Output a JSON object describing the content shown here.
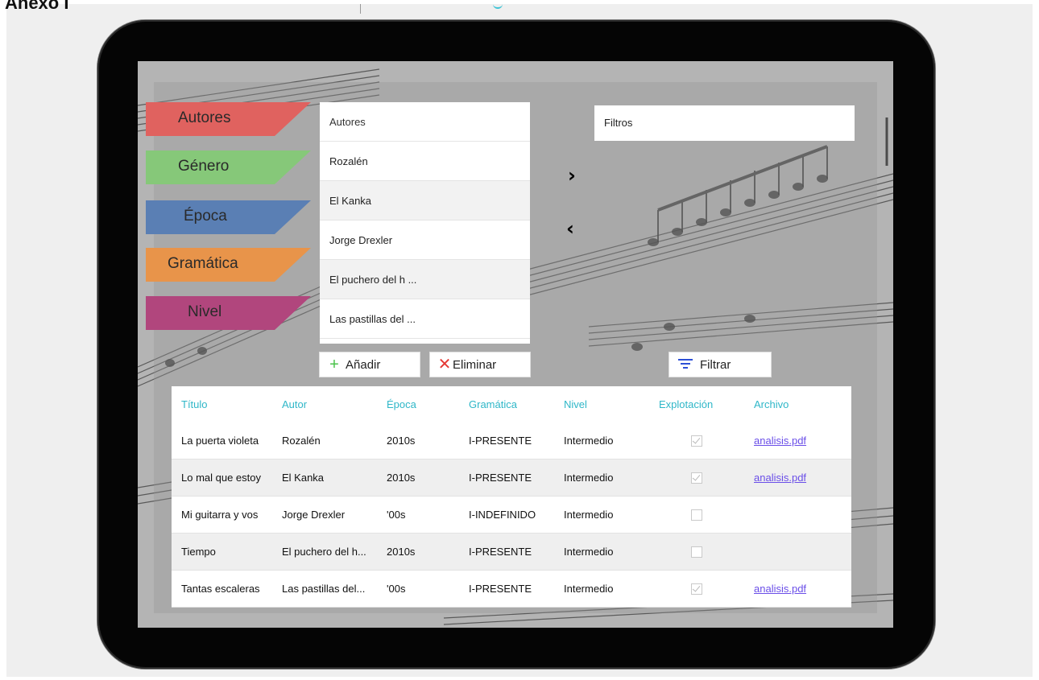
{
  "page": {
    "heading": "Anexo I"
  },
  "categories": [
    {
      "label": "Autores",
      "color": "#e0625f"
    },
    {
      "label": "Género",
      "color": "#86c879"
    },
    {
      "label": "Época",
      "color": "#5a7fb4"
    },
    {
      "label": "Gramática",
      "color": "#e8944a"
    },
    {
      "label": "Nivel",
      "color": "#b1467d"
    }
  ],
  "list": {
    "header": "Autores",
    "items": [
      "Rozalén",
      "El Kanka",
      "Jorge Drexler",
      "El puchero del h ...",
      "Las pastillas del ..."
    ]
  },
  "filters": {
    "label": "Filtros"
  },
  "arrows": {
    "add": "›",
    "remove": "‹"
  },
  "buttons": {
    "add": "Añadir",
    "remove": "Eliminar",
    "filter": "Filtrar"
  },
  "table": {
    "columns": [
      "Título",
      "Autor",
      "Época",
      "Gramática",
      "Nivel",
      "Explotación",
      "Archivo"
    ],
    "rows": [
      {
        "title": "La puerta violeta",
        "author": "Rozalén",
        "era": "2010s",
        "grammar": "I-PRESENTE",
        "level": "Intermedio",
        "exploitation": true,
        "file": "analisis.pdf"
      },
      {
        "title": "Lo mal que estoy",
        "author": "El Kanka",
        "era": "2010s",
        "grammar": "I-PRESENTE",
        "level": "Intermedio",
        "exploitation": true,
        "file": "analisis.pdf"
      },
      {
        "title": "Mi guitarra y vos",
        "author": "Jorge Drexler",
        "era": "'00s",
        "grammar": "I-INDEFINIDO",
        "level": "Intermedio",
        "exploitation": false,
        "file": ""
      },
      {
        "title": "Tiempo",
        "author": "El puchero del h...",
        "era": "2010s",
        "grammar": "I-PRESENTE",
        "level": "Intermedio",
        "exploitation": false,
        "file": ""
      },
      {
        "title": "Tantas escaleras",
        "author": "Las pastillas del...",
        "era": "'00s",
        "grammar": "I-PRESENTE",
        "level": "Intermedio",
        "exploitation": true,
        "file": "analisis.pdf"
      }
    ]
  },
  "colors": {
    "accent": "#2fb7c8",
    "link": "#6a4ee8",
    "add_icon": "#49c24a",
    "remove_icon": "#e53935",
    "filter_icon": "#2c4fd6"
  },
  "icons": {
    "add": "plus-icon",
    "remove": "x-icon",
    "filter": "filter-lines-icon",
    "checkbox": "checkbox-icon"
  }
}
